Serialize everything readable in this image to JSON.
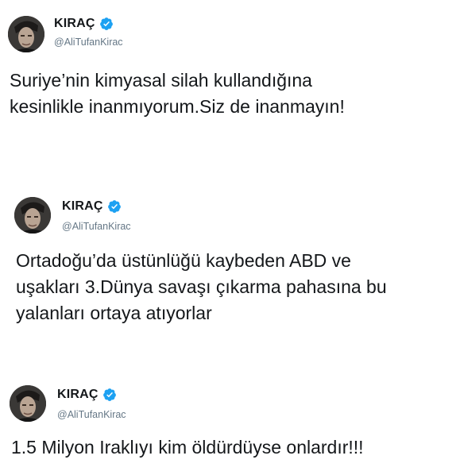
{
  "tweets": [
    {
      "display_name": "KIRAÇ",
      "handle": "@AliTufanKirac",
      "text": "Suriye’nin kimyasal silah kullandığına\nkesinlikle inanmıyorum.Siz de inanmayın!"
    },
    {
      "display_name": "KIRAÇ",
      "handle": "@AliTufanKirac",
      "text": "Ortadoğu’da üstünlüğü kaybeden ABD ve\nuşakları 3.Dünya savaşı çıkarma pahasına bu\nyalanları ortaya atıyorlar"
    },
    {
      "display_name": "KIRAÇ",
      "handle": "@AliTufanKirac",
      "text": "1.5 Milyon Iraklıyı kim öldürdüyse onlardır!!!"
    }
  ],
  "colors": {
    "verified_badge": "#1da1f2",
    "handle": "#657786",
    "text": "#14171a"
  },
  "icons": {
    "verified": "verified-badge-icon",
    "avatar": "profile-avatar"
  }
}
